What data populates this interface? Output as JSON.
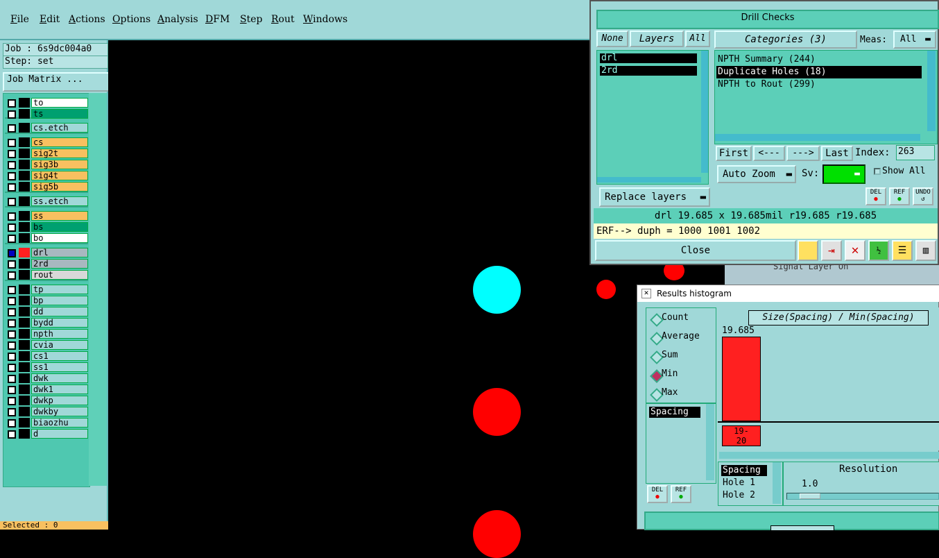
{
  "menubar": {
    "items": [
      "File",
      "Edit",
      "Actions",
      "Options",
      "Analysis",
      "DFM",
      "Step",
      "Rout",
      "Windows"
    ]
  },
  "left_panel": {
    "job": "Job : 6s9dc004a0",
    "step": "Step: set",
    "job_matrix": "Job Matrix ...",
    "layers": [
      {
        "name": "to",
        "color": "#ffffff"
      },
      {
        "name": "ts",
        "color": "#00a070"
      },
      {
        "name": "cs.etch",
        "color": "#a0d8d8"
      },
      {
        "name": "cs",
        "color": "#f8c060"
      },
      {
        "name": "sig2t",
        "color": "#f8c060"
      },
      {
        "name": "sig3b",
        "color": "#f8c060"
      },
      {
        "name": "sig4t",
        "color": "#f8c060"
      },
      {
        "name": "sig5b",
        "color": "#f8c060"
      },
      {
        "name": "ss.etch",
        "color": "#a0d8d8"
      },
      {
        "name": "ss",
        "color": "#f8c060"
      },
      {
        "name": "bs",
        "color": "#00a070"
      },
      {
        "name": "bo",
        "color": "#ffffff"
      },
      {
        "name": "drl",
        "color": "#a8b8c0"
      },
      {
        "name": "2rd",
        "color": "#a8b8c0"
      },
      {
        "name": "rout",
        "color": "#d8d8d8"
      },
      {
        "name": "tp",
        "color": "#a0d8d8"
      },
      {
        "name": "bp",
        "color": "#a0d8d8"
      },
      {
        "name": "dd",
        "color": "#a0d8d8"
      },
      {
        "name": "bydd",
        "color": "#a0d8d8"
      },
      {
        "name": "npth",
        "color": "#a0d8d8"
      },
      {
        "name": "cvia",
        "color": "#a0d8d8"
      },
      {
        "name": "cs1",
        "color": "#a0d8d8"
      },
      {
        "name": "ss1",
        "color": "#a0d8d8"
      },
      {
        "name": "dwk",
        "color": "#a0d8d8"
      },
      {
        "name": "dwk1",
        "color": "#a0d8d8"
      },
      {
        "name": "dwkp",
        "color": "#a0d8d8"
      },
      {
        "name": "dwkby",
        "color": "#a0d8d8"
      },
      {
        "name": "biaozhu",
        "color": "#a0d8d8"
      },
      {
        "name": "d",
        "color": "#a0d8d8"
      }
    ],
    "status": "Selected : 0"
  },
  "drill_checks": {
    "title": "Drill Checks",
    "none_btn": "None",
    "layers_btn": "Layers",
    "all_btn": "All",
    "layer_items": [
      "drl",
      "2rd"
    ],
    "categories_btn": "Categories (3)",
    "meas_label": "Meas:",
    "meas_value": "All",
    "categories": [
      "NPTH Summary (244)",
      "Duplicate Holes (18)",
      "NPTH to Rout (299)"
    ],
    "first_btn": "First",
    "prev_btn": "<---",
    "next_btn": "--->",
    "last_btn": "Last",
    "index_label": "Index:",
    "index_value": "263",
    "auto_zoom": "Auto Zoom",
    "sv_label": "Sv:",
    "show_all": "Show All",
    "replace_layers": "Replace layers",
    "del_icon": "DEL",
    "ref_icon": "REF",
    "undo_icon": "UNDO",
    "info_line": "drl  19.685 x 19.685mil  r19.685  r19.685",
    "erf_line": "ERF--> duph = 1000 1001 1002",
    "close_btn": "Close"
  },
  "histogram": {
    "title": "Results histogram",
    "options": [
      "Count",
      "Average",
      "Sum",
      "Min",
      "Max"
    ],
    "selected_option": "Min",
    "chart_title": "Size(Spacing) / Min(Spacing)",
    "bar_value": "19.685",
    "bar_label_line1": "19-",
    "bar_label_line2": "20",
    "left_list": [
      "Spacing"
    ],
    "sort_list": [
      "Spacing",
      "Hole 1",
      "Hole 2"
    ],
    "resolution_label": "Resolution",
    "resolution_value": "1.0",
    "del_icon": "DEL",
    "ref_icon": "REF"
  },
  "background_window": {
    "text": "Signal Layer On"
  }
}
